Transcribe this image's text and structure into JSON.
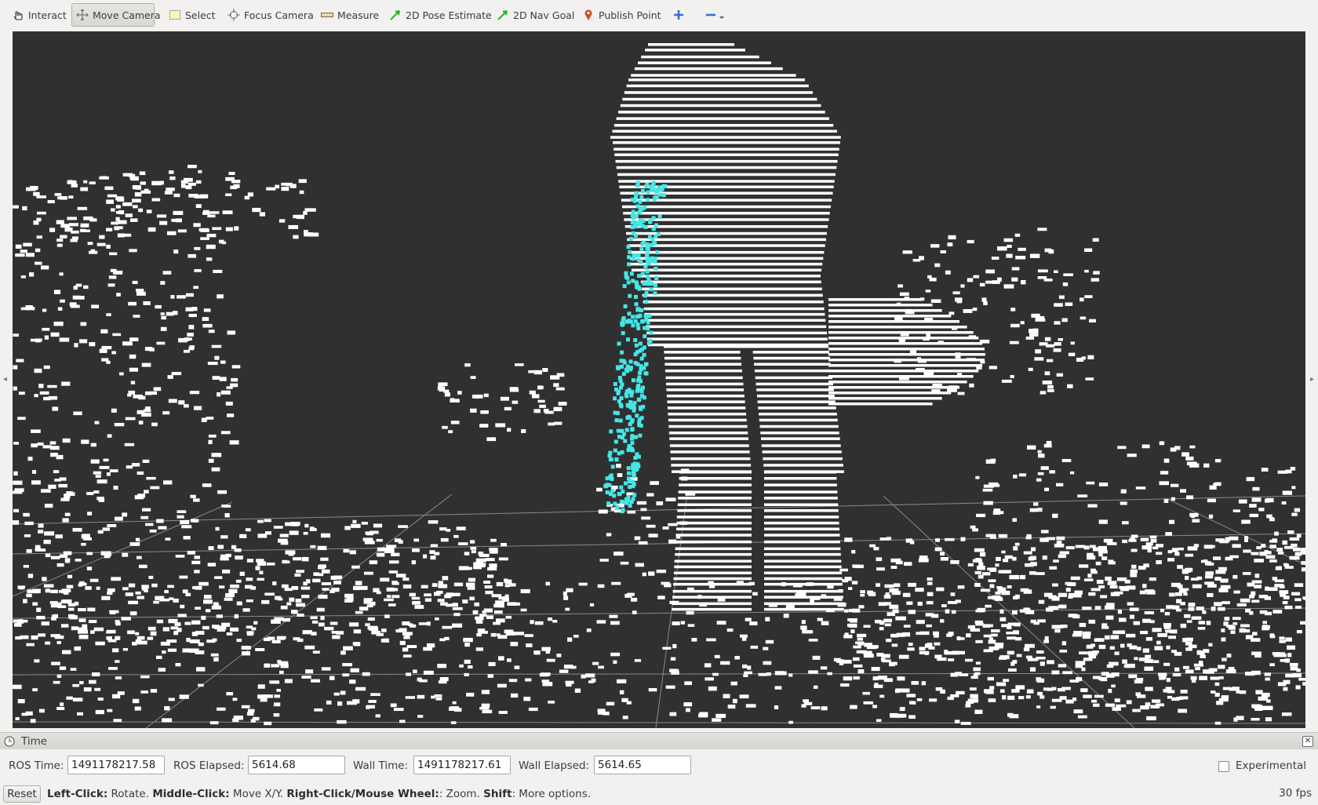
{
  "toolbar": {
    "tools": [
      {
        "label": "Interact",
        "icon": "hand-pointer-icon"
      },
      {
        "label": "Move Camera",
        "icon": "move-arrows-icon",
        "active": true
      },
      {
        "label": "Select",
        "icon": "select-box-icon"
      },
      {
        "label": "Focus Camera",
        "icon": "crosshair-icon"
      },
      {
        "label": "Measure",
        "icon": "ruler-icon"
      },
      {
        "label": "2D Pose Estimate",
        "icon": "green-arrow-icon"
      },
      {
        "label": "2D Nav Goal",
        "icon": "green-arrow-icon"
      },
      {
        "label": "Publish Point",
        "icon": "map-pin-icon"
      }
    ],
    "add_tool_icon": "plus-icon",
    "remove_tool_icon": "minus-dropdown-icon"
  },
  "viewport": {
    "background": "#303030",
    "point_color": "#ffffff",
    "highlight_color": "#40e6e6",
    "grid_color": "#a0a0a0"
  },
  "time_panel": {
    "title": "Time",
    "ros_time_label": "ROS Time:",
    "ros_time_value": "1491178217.58",
    "ros_elapsed_label": "ROS Elapsed:",
    "ros_elapsed_value": "5614.68",
    "wall_time_label": "Wall Time:",
    "wall_time_value": "1491178217.61",
    "wall_elapsed_label": "Wall Elapsed:",
    "wall_elapsed_value": "5614.65",
    "experimental_label": "Experimental",
    "experimental_checked": false
  },
  "status": {
    "reset_label": "Reset",
    "hint_parts": [
      {
        "text": "Left-Click:",
        "bold": true
      },
      {
        "text": " Rotate. ",
        "bold": false
      },
      {
        "text": "Middle-Click:",
        "bold": true
      },
      {
        "text": " Move X/Y. ",
        "bold": false
      },
      {
        "text": "Right-Click/Mouse Wheel:",
        "bold": true
      },
      {
        "text": ": Zoom. ",
        "bold": false
      },
      {
        "text": "Shift",
        "bold": true
      },
      {
        "text": ": More options.",
        "bold": false
      }
    ],
    "fps": "30 fps"
  }
}
